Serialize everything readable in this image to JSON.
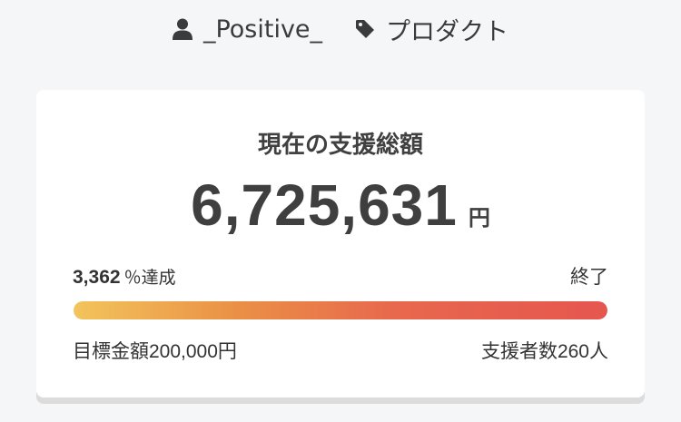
{
  "meta": {
    "author": "_Positive_",
    "category": "プロダクト"
  },
  "funding": {
    "title": "現在の支援総額",
    "amount": "6,725,631",
    "currency": "円",
    "percent": "3,362",
    "percent_suffix": "％達成",
    "status": "終了",
    "progress_fill": 1.0,
    "target_label": "目標金額",
    "target_amount": "200,000",
    "target_unit": "円",
    "supporters_label": "支援者数",
    "supporters_count": "260",
    "supporters_unit": "人"
  },
  "colors": {
    "progress_start": "#f3c45c",
    "progress_end": "#e5564f",
    "text": "#3f3f3f",
    "background": "#f5f6f7"
  },
  "icons": {
    "author": "user-icon",
    "category": "tag-icon"
  }
}
